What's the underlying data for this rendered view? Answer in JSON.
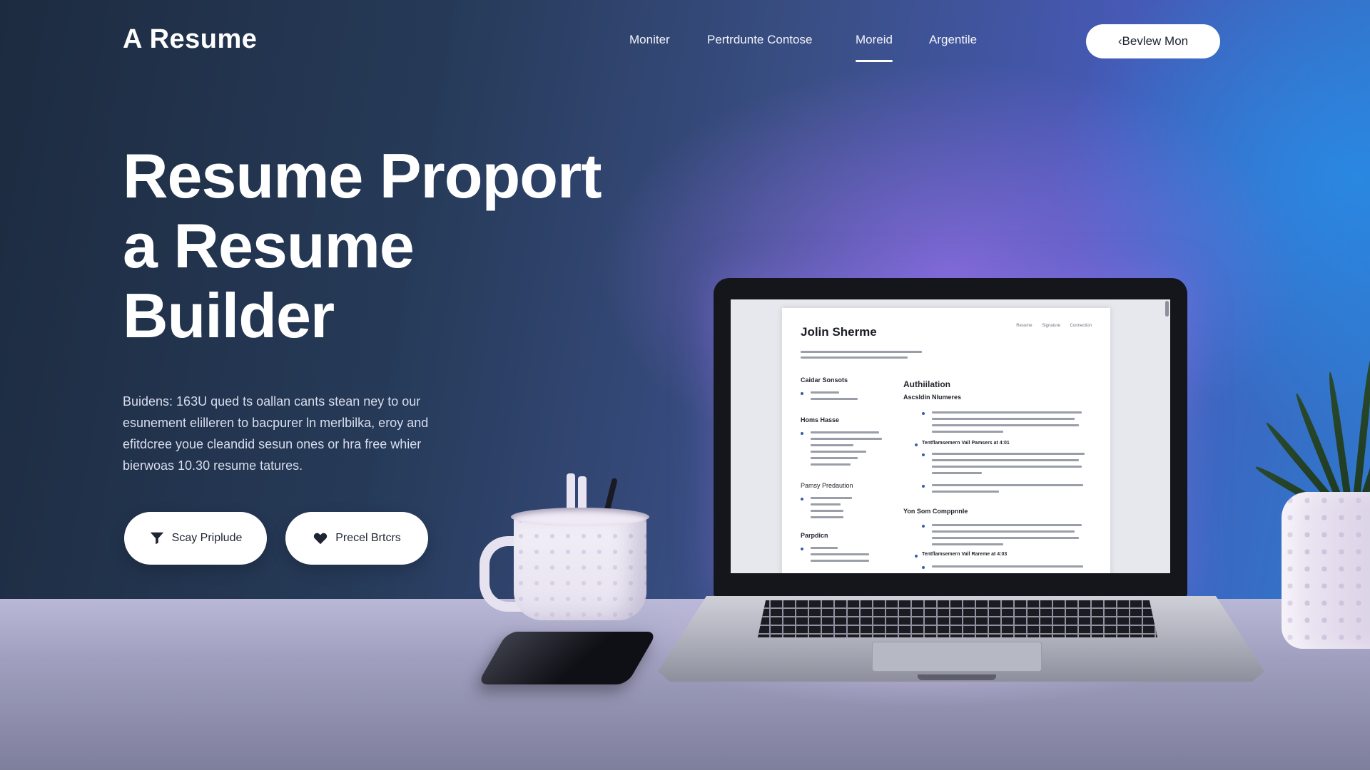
{
  "brand": {
    "name": "A Resume"
  },
  "nav": {
    "items": [
      {
        "label": "Moniter",
        "active": false
      },
      {
        "label": "Pertrdunte Contose",
        "active": false
      },
      {
        "label": "Moreid",
        "active": true
      },
      {
        "label": "Argentile",
        "active": false
      }
    ],
    "cta_label": "‹Bevlew Mon"
  },
  "hero": {
    "title_lines": [
      "Resume Proport",
      "a Resume",
      "Builder"
    ],
    "description": "Buidens: 163U qued ts oallan cants stean ney to our esunement elilleren to bacpurer ln merlbilka, eroy and efitdcree youe cleandid sesun ones or hra free whier bierwoas 10.30 resume tatures.",
    "buttons": [
      {
        "label": "Scay Priplude",
        "icon": "funnel-icon"
      },
      {
        "label": "Precel Brtcrs",
        "icon": "heart-icon"
      }
    ]
  },
  "resume_preview": {
    "name": "Jolin Sherme",
    "header_links": [
      "Resume",
      "Signature",
      "Connection"
    ],
    "left_sections": [
      "Caidar Sonsots",
      "Homs Hasse",
      "Pamsy Predaution",
      "Parpdicn"
    ],
    "right_sections": [
      "Authiilation",
      "Ascsldin Nlumeres",
      "Tentflamsemern Vall Pamsers at 4:01",
      "Yon Som Comppnnle",
      "Tentflamsemern Vall Rareme at 4:03"
    ]
  },
  "colors": {
    "accent": "#4659b5",
    "background_dark": "#1d2b40",
    "button_bg": "#ffffff"
  }
}
